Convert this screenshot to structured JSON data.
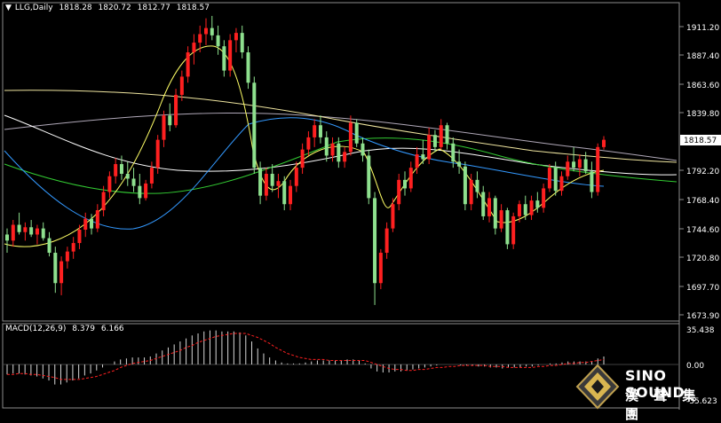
{
  "header": {
    "symbol": "LLG,Daily",
    "open": "1818.28",
    "high": "1820.72",
    "low": "1812.77",
    "close": "1818.57"
  },
  "macd_header": {
    "label": "MACD(12,26,9)",
    "macd": "8.379",
    "signal": "6.166"
  },
  "price_axis": {
    "ticks": [
      "1911.20",
      "1887.40",
      "1863.60",
      "1839.80",
      "1792.20",
      "1768.40",
      "1744.60",
      "1720.80",
      "1697.70",
      "1673.90"
    ],
    "current_price": "1818.57"
  },
  "macd_axis": {
    "ticks": [
      "35.438",
      "0.00",
      "-35.623"
    ]
  },
  "logo": {
    "text_en": "SINO SOUND",
    "text_cn": "漢 聲 集 團"
  },
  "colors": {
    "background": "#000000",
    "bull_candle": "#ff2020",
    "bear_candle": "#8ee08e",
    "ma_yellow": "#ffff66",
    "ma_blue": "#3399ff",
    "ma_green": "#33cc33",
    "ma_white": "#ffffff",
    "ma_beige": "#f0e6a0",
    "ma_gray": "#b0a8b8",
    "macd_signal": "#ff2020"
  },
  "chart_data": [
    {
      "type": "candlestick",
      "ylim": [
        1673.9,
        1925
      ],
      "candles": [
        [
          1740,
          1745,
          1725,
          1735
        ],
        [
          1735,
          1752,
          1730,
          1748
        ],
        [
          1748,
          1758,
          1740,
          1742
        ],
        [
          1742,
          1750,
          1735,
          1746
        ],
        [
          1746,
          1752,
          1738,
          1740
        ],
        [
          1740,
          1748,
          1732,
          1745
        ],
        [
          1745,
          1750,
          1735,
          1737
        ],
        [
          1737,
          1742,
          1722,
          1725
        ],
        [
          1725,
          1730,
          1692,
          1700
        ],
        [
          1700,
          1722,
          1690,
          1718
        ],
        [
          1718,
          1730,
          1712,
          1726
        ],
        [
          1726,
          1738,
          1720,
          1733
        ],
        [
          1733,
          1748,
          1728,
          1744
        ],
        [
          1744,
          1758,
          1738,
          1753
        ],
        [
          1753,
          1757,
          1740,
          1745
        ],
        [
          1745,
          1765,
          1742,
          1760
        ],
        [
          1760,
          1780,
          1755,
          1775
        ],
        [
          1775,
          1792,
          1770,
          1788
        ],
        [
          1788,
          1803,
          1782,
          1798
        ],
        [
          1798,
          1805,
          1785,
          1790
        ],
        [
          1790,
          1800,
          1780,
          1786
        ],
        [
          1786,
          1795,
          1775,
          1780
        ],
        [
          1780,
          1790,
          1765,
          1770
        ],
        [
          1770,
          1785,
          1768,
          1782
        ],
        [
          1782,
          1800,
          1778,
          1795
        ],
        [
          1795,
          1822,
          1790,
          1818
        ],
        [
          1818,
          1842,
          1812,
          1838
        ],
        [
          1838,
          1848,
          1825,
          1830
        ],
        [
          1830,
          1860,
          1828,
          1855
        ],
        [
          1855,
          1875,
          1850,
          1870
        ],
        [
          1870,
          1895,
          1865,
          1890
        ],
        [
          1890,
          1905,
          1880,
          1898
        ],
        [
          1898,
          1912,
          1890,
          1905
        ],
        [
          1905,
          1918,
          1896,
          1910
        ],
        [
          1910,
          1920,
          1900,
          1904
        ],
        [
          1904,
          1912,
          1888,
          1895
        ],
        [
          1895,
          1900,
          1870,
          1875
        ],
        [
          1875,
          1905,
          1870,
          1900
        ],
        [
          1900,
          1910,
          1890,
          1906
        ],
        [
          1906,
          1912,
          1885,
          1890
        ],
        [
          1890,
          1895,
          1860,
          1865
        ],
        [
          1865,
          1870,
          1790,
          1795
        ],
        [
          1795,
          1800,
          1765,
          1772
        ],
        [
          1772,
          1795,
          1768,
          1790
        ],
        [
          1790,
          1798,
          1775,
          1780
        ],
        [
          1780,
          1790,
          1770,
          1784
        ],
        [
          1784,
          1788,
          1760,
          1765
        ],
        [
          1765,
          1785,
          1760,
          1780
        ],
        [
          1780,
          1800,
          1775,
          1795
        ],
        [
          1795,
          1815,
          1790,
          1810
        ],
        [
          1810,
          1825,
          1805,
          1820
        ],
        [
          1820,
          1835,
          1812,
          1830
        ],
        [
          1830,
          1838,
          1815,
          1820
        ],
        [
          1820,
          1825,
          1800,
          1805
        ],
        [
          1805,
          1820,
          1800,
          1815
        ],
        [
          1815,
          1820,
          1795,
          1800
        ],
        [
          1800,
          1812,
          1795,
          1808
        ],
        [
          1808,
          1838,
          1805,
          1832
        ],
        [
          1832,
          1835,
          1812,
          1815
        ],
        [
          1815,
          1820,
          1800,
          1805
        ],
        [
          1805,
          1810,
          1765,
          1770
        ],
        [
          1770,
          1775,
          1682,
          1700
        ],
        [
          1700,
          1728,
          1695,
          1725
        ],
        [
          1725,
          1750,
          1720,
          1745
        ],
        [
          1745,
          1770,
          1742,
          1765
        ],
        [
          1765,
          1790,
          1760,
          1785
        ],
        [
          1785,
          1792,
          1772,
          1778
        ],
        [
          1778,
          1800,
          1775,
          1795
        ],
        [
          1795,
          1812,
          1790,
          1806
        ],
        [
          1806,
          1818,
          1798,
          1802
        ],
        [
          1802,
          1828,
          1798,
          1822
        ],
        [
          1822,
          1826,
          1808,
          1812
        ],
        [
          1812,
          1835,
          1810,
          1830
        ],
        [
          1830,
          1832,
          1810,
          1815
        ],
        [
          1815,
          1820,
          1795,
          1800
        ],
        [
          1800,
          1810,
          1790,
          1796
        ],
        [
          1796,
          1800,
          1760,
          1765
        ],
        [
          1765,
          1790,
          1760,
          1785
        ],
        [
          1785,
          1792,
          1770,
          1775
        ],
        [
          1775,
          1780,
          1752,
          1755
        ],
        [
          1755,
          1775,
          1750,
          1770
        ],
        [
          1770,
          1772,
          1740,
          1745
        ],
        [
          1745,
          1765,
          1742,
          1760
        ],
        [
          1760,
          1762,
          1728,
          1732
        ],
        [
          1732,
          1758,
          1728,
          1755
        ],
        [
          1755,
          1768,
          1750,
          1765
        ],
        [
          1765,
          1772,
          1752,
          1756
        ],
        [
          1756,
          1772,
          1752,
          1768
        ],
        [
          1768,
          1775,
          1758,
          1762
        ],
        [
          1762,
          1782,
          1758,
          1778
        ],
        [
          1778,
          1798,
          1775,
          1795
        ],
        [
          1795,
          1800,
          1772,
          1776
        ],
        [
          1776,
          1792,
          1772,
          1788
        ],
        [
          1788,
          1805,
          1785,
          1800
        ],
        [
          1800,
          1812,
          1792,
          1795
        ],
        [
          1795,
          1806,
          1788,
          1802
        ],
        [
          1802,
          1808,
          1790,
          1792
        ],
        [
          1792,
          1800,
          1770,
          1775
        ],
        [
          1775,
          1815,
          1772,
          1812
        ],
        [
          1812,
          1821,
          1810,
          1818
        ]
      ]
    },
    {
      "type": "bar",
      "ylim": [
        -35.623,
        35.438
      ],
      "values": [
        -10,
        -9,
        -9,
        -10,
        -11,
        -12,
        -14,
        -16,
        -20,
        -20,
        -18,
        -16,
        -14,
        -11,
        -9,
        -6,
        -3,
        0,
        3,
        5,
        6,
        7,
        7,
        7,
        8,
        11,
        14,
        17,
        20,
        23,
        26,
        29,
        31,
        33,
        34,
        34,
        33,
        33,
        33,
        32,
        29,
        23,
        16,
        11,
        7,
        4,
        2,
        1,
        1,
        1,
        2,
        3,
        4,
        4,
        4,
        4,
        4,
        5,
        5,
        4,
        1,
        -4,
        -7,
        -8,
        -8,
        -7,
        -7,
        -6,
        -5,
        -4,
        -3,
        -2,
        -1,
        0,
        0,
        0,
        -1,
        -1,
        -1,
        -2,
        -2,
        -3,
        -3,
        -4,
        -3,
        -3,
        -3,
        -2,
        -2,
        -1,
        0,
        1,
        1,
        2,
        3,
        3,
        3,
        3,
        3,
        6,
        8
      ],
      "signal": [
        -10,
        -10,
        -9,
        -9,
        -10,
        -10,
        -11,
        -12,
        -13,
        -15,
        -15,
        -15,
        -15,
        -14,
        -13,
        -12,
        -10,
        -8,
        -6,
        -3,
        -1,
        1,
        2,
        3,
        4,
        6,
        8,
        10,
        12,
        14,
        17,
        19,
        22,
        24,
        26,
        28,
        29,
        30,
        31,
        31,
        31,
        29,
        27,
        24,
        21,
        17,
        14,
        11,
        9,
        7,
        6,
        5,
        5,
        5,
        4,
        4,
        4,
        4,
        4,
        4,
        4,
        2,
        0,
        -2,
        -4,
        -5,
        -5,
        -6,
        -6,
        -5,
        -5,
        -4,
        -3,
        -3,
        -2,
        -2,
        -1,
        -1,
        -1,
        -1,
        -1,
        -2,
        -2,
        -2,
        -3,
        -3,
        -3,
        -3,
        -3,
        -2,
        -2,
        -1,
        -1,
        0,
        1,
        1,
        2,
        2,
        3,
        4,
        5
      ]
    }
  ]
}
